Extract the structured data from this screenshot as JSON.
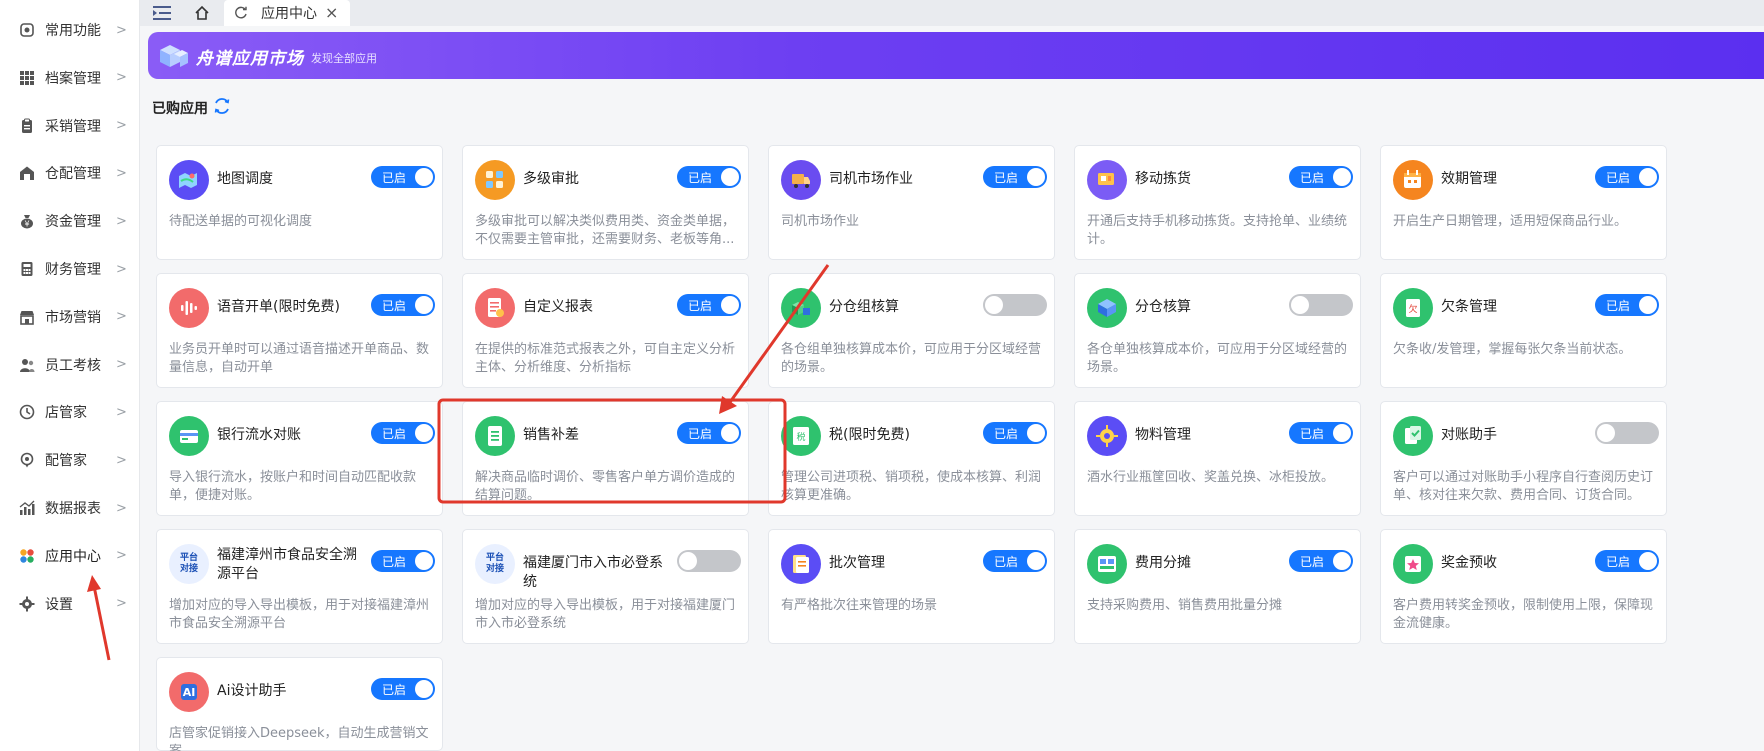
{
  "sidebar": {
    "items": [
      {
        "label": "常用功能",
        "icon": "common-icon"
      },
      {
        "label": "档案管理",
        "icon": "grid-icon"
      },
      {
        "label": "采销管理",
        "icon": "clipboard-icon"
      },
      {
        "label": "仓配管理",
        "icon": "warehouse-icon"
      },
      {
        "label": "资金管理",
        "icon": "money-bag-icon"
      },
      {
        "label": "财务管理",
        "icon": "calculator-icon"
      },
      {
        "label": "市场营销",
        "icon": "store-icon"
      },
      {
        "label": "员工考核",
        "icon": "users-icon"
      },
      {
        "label": "店管家",
        "icon": "shop-manager-icon"
      },
      {
        "label": "配管家",
        "icon": "delivery-manager-icon"
      },
      {
        "label": "数据报表",
        "icon": "bar-chart-icon"
      },
      {
        "label": "应用中心",
        "icon": "apps-icon"
      },
      {
        "label": "设置",
        "icon": "gear-icon"
      }
    ],
    "chevron": ">"
  },
  "tabbar": {
    "active_tab": "应用中心",
    "close": "×"
  },
  "banner": {
    "title": "舟谱应用市场",
    "subtitle": "发现全部应用"
  },
  "section": {
    "title": "已购应用"
  },
  "toggle_on_label": "已启",
  "apps": [
    {
      "title": "地图调度",
      "desc": "待配送单据的可视化调度",
      "on": true,
      "icon": "map-icon",
      "color": "#5b4df5"
    },
    {
      "title": "多级审批",
      "desc": "多级审批可以解决类似费用类、资金类单据，不仅需要主管审批，还需要财务、老板等角...",
      "on": true,
      "icon": "approval-icon",
      "color": "#f59a23"
    },
    {
      "title": "司机市场作业",
      "desc": "司机市场作业",
      "on": true,
      "icon": "truck-icon",
      "color": "#6a4cf0"
    },
    {
      "title": "移动拣货",
      "desc": "开通后支持手机移动拣货。支持抢单、业绩统计。",
      "on": true,
      "icon": "picking-icon",
      "color": "#7b5cf5"
    },
    {
      "title": "效期管理",
      "desc": "开启生产日期管理，适用短保商品行业。",
      "on": true,
      "icon": "calendar-icon",
      "color": "#f5851f"
    },
    {
      "title": "语音开单(限时免费)",
      "desc": "业务员开单时可以通过语音描述开单商品、数量信息，自动开单",
      "on": true,
      "icon": "voice-icon",
      "color": "#f26b6b"
    },
    {
      "title": "自定义报表",
      "desc": "在提供的标准范式报表之外，可自主定义分析主体、分析维度、分析指标",
      "on": true,
      "icon": "report-icon",
      "color": "#f26b6b"
    },
    {
      "title": "分仓组核算",
      "desc": "各仓组单独核算成本价，可应用于分区域经营的场景。",
      "on": false,
      "icon": "cubes-icon",
      "color": "#2fc26e"
    },
    {
      "title": "分仓核算",
      "desc": "各仓单独核算成本价，可应用于分区域经营的场景。",
      "on": false,
      "icon": "cube-icon",
      "color": "#2fc26e"
    },
    {
      "title": "欠条管理",
      "desc": "欠条收/发管理，掌握每张欠条当前状态。",
      "on": true,
      "icon": "iou-icon",
      "color": "#2fc26e"
    },
    {
      "title": "银行流水对账",
      "desc": "导入银行流水，按账户和时间自动匹配收款单，便捷对账。",
      "on": true,
      "icon": "bank-icon",
      "color": "#2fc26e"
    },
    {
      "title": "销售补差",
      "desc": "解决商品临时调价、零售客户单方调价造成的结算问题。",
      "on": true,
      "icon": "document-icon",
      "color": "#2fc26e"
    },
    {
      "title": "税(限时免费)",
      "desc": "管理公司进项税、销项税，使成本核算、利润核算更准确。",
      "on": true,
      "icon": "tax-icon",
      "color": "#2fc26e"
    },
    {
      "title": "物料管理",
      "desc": "酒水行业瓶筐回收、奖盖兑换、冰柜投放。",
      "on": true,
      "icon": "gear-material-icon",
      "color": "#5b4df5"
    },
    {
      "title": "对账助手",
      "desc": "客户可以通过对账助手小程序自行查阅历史订单、核对往来欠款、费用合同、订货合同。",
      "on": false,
      "icon": "reconcile-icon",
      "color": "#2fc26e"
    },
    {
      "title": "福建漳州市食品安全溯源平台",
      "desc": "增加对应的导入导出模板，用于对接福建漳州市食品安全溯源平台",
      "on": true,
      "icon": "platform-dock-icon",
      "color": "#e9f0ff",
      "badge": "平台 对接"
    },
    {
      "title": "福建厦门市入市必登系统",
      "desc": "增加对应的导入导出模板，用于对接福建厦门市入市必登系统",
      "on": false,
      "icon": "platform-dock-icon",
      "color": "#e9f0ff",
      "badge": "平台 对接"
    },
    {
      "title": "批次管理",
      "desc": "有严格批次往来管理的场景",
      "on": true,
      "icon": "batch-icon",
      "color": "#5b4df5"
    },
    {
      "title": "费用分摊",
      "desc": "支持采购费用、销售费用批量分摊",
      "on": true,
      "icon": "expense-icon",
      "color": "#2fc26e"
    },
    {
      "title": "奖金预收",
      "desc": "客户费用转奖金预收，限制使用上限，保障现金流健康。",
      "on": true,
      "icon": "bonus-icon",
      "color": "#2fc26e"
    },
    {
      "title": "Ai设计助手",
      "desc": "店管家促销接入Deepseek，自动生成营销文案",
      "on": true,
      "icon": "ai-icon",
      "color": "#f26b6b",
      "badge": "AI"
    }
  ],
  "colors": {
    "toggle_on": "#1677ff",
    "toggle_off": "#c4c6ca",
    "annotation": "#e0382c",
    "banner_start": "#8a5cf6",
    "banner_end": "#5b2ff0"
  }
}
